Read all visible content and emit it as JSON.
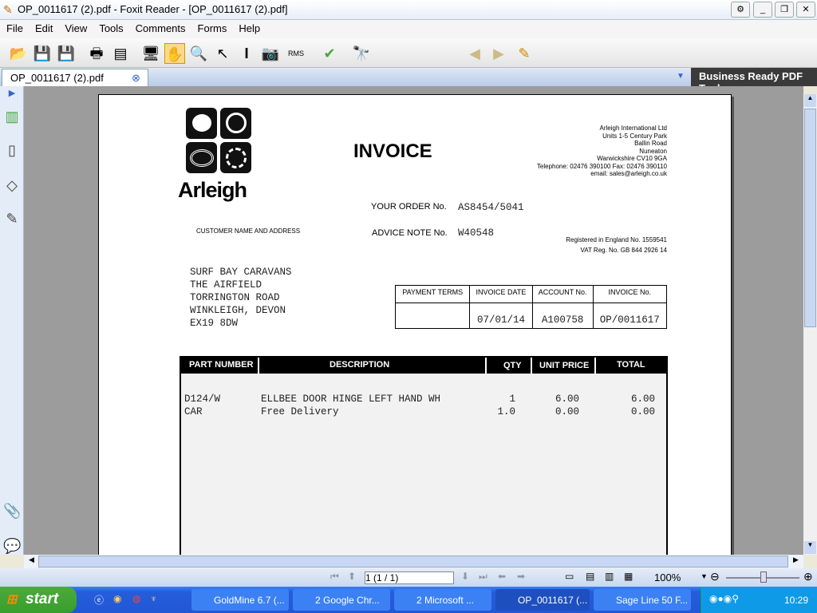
{
  "window": {
    "title": "OP_0011617 (2).pdf - Foxit Reader - [OP_0011617 (2).pdf]"
  },
  "menu": [
    "File",
    "Edit",
    "View",
    "Tools",
    "Comments",
    "Forms",
    "Help"
  ],
  "tab": {
    "label": "OP_0011617 (2).pdf"
  },
  "brand": "Business Ready PDF Tool",
  "toolbar": {
    "search_value": "",
    "rms_label": "RMS"
  },
  "invoice": {
    "logo_text": "Arleigh",
    "title": "INVOICE",
    "company": [
      "Arleigh International Ltd",
      "Units 1-5 Century Park",
      "Ballin Road",
      "Nuneaton",
      "Warwickshire CV10 9GA",
      "Telephone: 02476 390100 Fax: 02476 390110",
      "email: sales@arleigh.co.uk"
    ],
    "registered": "Registered in England No. 1559541",
    "vat": "VAT Reg. No. GB 844 2926 14",
    "order_label": "YOUR ORDER No.",
    "order_value": "AS8454/5041",
    "advice_label": "ADVICE NOTE No.",
    "advice_value": "W40548",
    "customer_label": "CUSTOMER NAME AND ADDRESS",
    "customer": [
      "SURF BAY CARAVANS",
      "THE AIRFIELD",
      "TORRINGTON ROAD",
      "WINKLEIGH, DEVON",
      "EX19 8DW"
    ],
    "terms_headers": [
      "PAYMENT TERMS",
      "INVOICE DATE",
      "ACCOUNT No.",
      "INVOICE No."
    ],
    "terms_values": [
      "",
      "07/01/14",
      "A100758",
      "OP/0011617"
    ],
    "columns": [
      "PART NUMBER",
      "DESCRIPTION",
      "QTY",
      "UNIT PRICE",
      "TOTAL"
    ],
    "rows": [
      {
        "part": "D124/W",
        "desc": "ELLBEE DOOR HINGE LEFT HAND WH",
        "qty": "1",
        "price": "6.00",
        "total": "6.00"
      },
      {
        "part": "CAR",
        "desc": "Free Delivery",
        "qty": "1.0",
        "price": "0.00",
        "total": "0.00"
      }
    ]
  },
  "status": {
    "page_value": "1 (1 / 1)",
    "zoom": "100%"
  },
  "taskbar": {
    "start": "start",
    "tasks": [
      "GoldMine 6.7 (...",
      "2 Google Chr...",
      "2 Microsoft ...",
      "OP_0011617 (...",
      "Sage Line 50 F..."
    ],
    "clock": "10:29"
  }
}
